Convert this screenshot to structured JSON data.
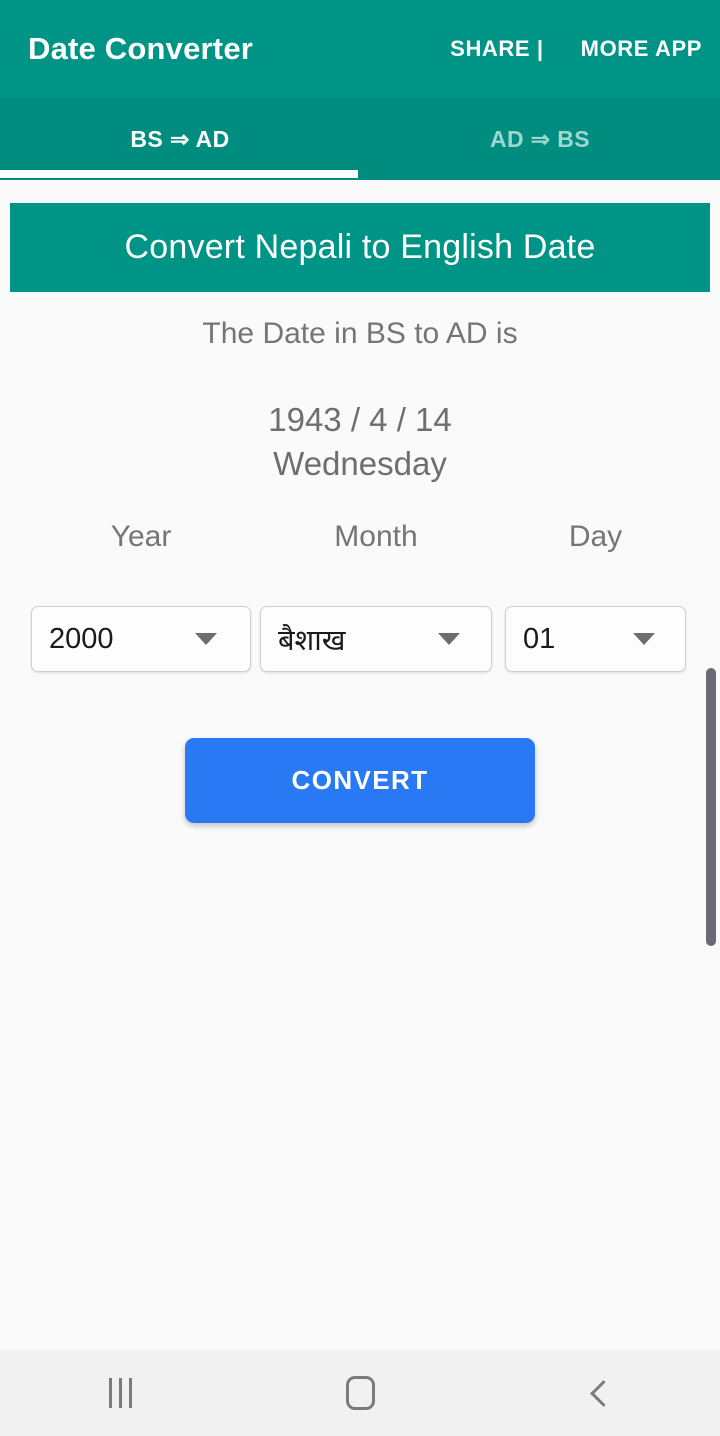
{
  "appbar": {
    "title": "Date Converter",
    "share_label": "SHARE |",
    "more_app_label": "MORE APP"
  },
  "tabs": [
    {
      "label": "BS ⇒ AD",
      "active": true
    },
    {
      "label": "AD ⇒ BS",
      "active": false
    }
  ],
  "banner": {
    "title": "Convert Nepali to English Date"
  },
  "result": {
    "label": "The Date in BS to AD is",
    "date": "1943 / 4 / 14",
    "weekday": "Wednesday"
  },
  "pickers": {
    "year": {
      "label": "Year",
      "value": "2000"
    },
    "month": {
      "label": "Month",
      "value": "बैशाख"
    },
    "day": {
      "label": "Day",
      "value": "01"
    }
  },
  "actions": {
    "convert_label": "CONVERT"
  },
  "navbar": {
    "recents": "recents-icon",
    "home": "home-icon",
    "back": "back-icon"
  },
  "colors": {
    "primary": "#009486",
    "primary_dark": "#008d7f",
    "accent_button": "#2979f5",
    "background": "#fafafa",
    "muted_text": "#757575",
    "inactive_tab": "#9fd6cf"
  }
}
